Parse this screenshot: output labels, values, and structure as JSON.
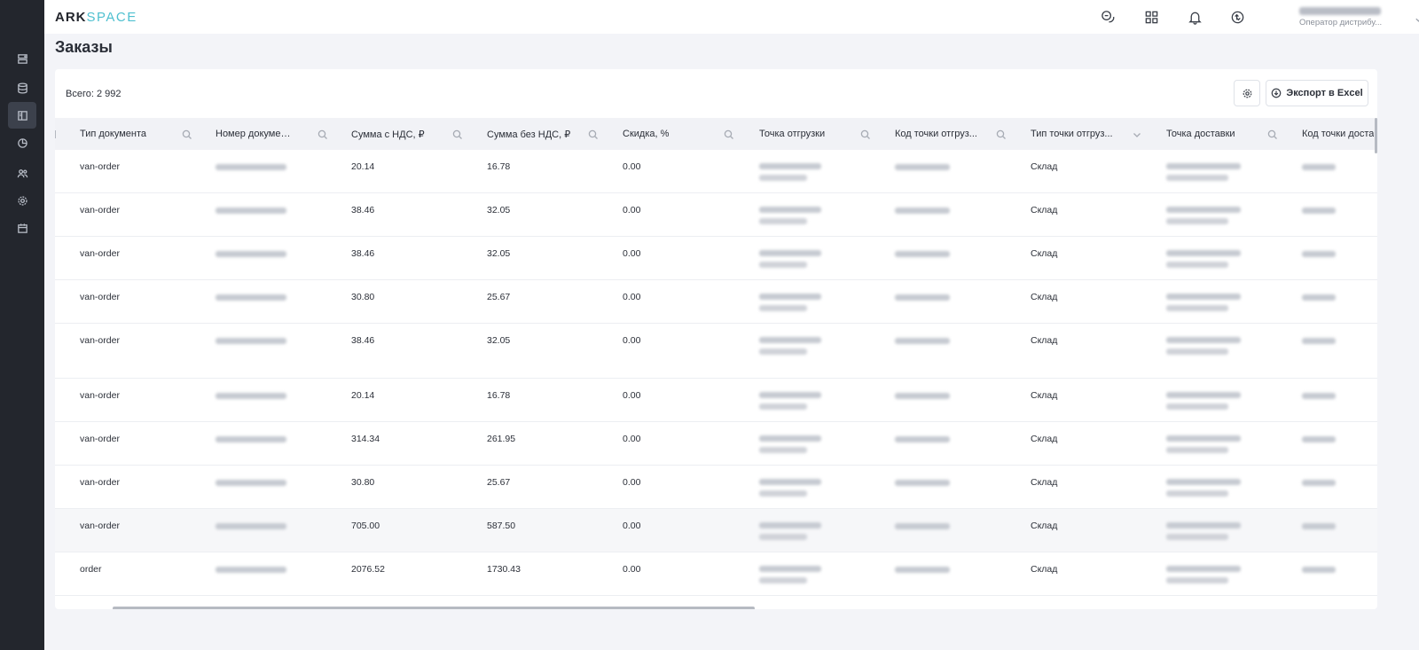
{
  "app": {
    "logo_part1": "ARK",
    "logo_part2": "SPACE",
    "user_role": "Оператор дистрибу...",
    "accent_color": "#4fc0d0"
  },
  "icons": {
    "sidebar": [
      "layers-icon",
      "database-icon",
      "orders-icon",
      "pie-chart-icon",
      "users-icon",
      "settings-icon",
      "calendar-icon"
    ],
    "header": [
      "chat-icon",
      "apps-grid-icon",
      "bell-icon",
      "sync-icon"
    ]
  },
  "page": {
    "title": "Заказы",
    "total_label": "Всего: 2 992",
    "export_label": "Экспорт в Excel"
  },
  "table": {
    "columns": [
      {
        "label": "Тип документа",
        "filter": "search"
      },
      {
        "label": "Номер докумен...",
        "filter": "search"
      },
      {
        "label": "Сумма с НДС, ₽",
        "filter": "search"
      },
      {
        "label": "Сумма без НДС, ₽",
        "filter": "search"
      },
      {
        "label": "Скидка, %",
        "filter": "search"
      },
      {
        "label": "Точка отгрузки",
        "filter": "search"
      },
      {
        "label": "Код точки отгруз...",
        "filter": "search"
      },
      {
        "label": "Тип точки отгруз...",
        "filter": "dropdown"
      },
      {
        "label": "Точка доставки",
        "filter": "search"
      },
      {
        "label": "Код точки доста",
        "filter": "none"
      }
    ],
    "rows": [
      {
        "doc_type": "van-order",
        "sum_vat": "20.14",
        "sum_novat": "16.78",
        "discount": "0.00",
        "ship_type": "Склад"
      },
      {
        "doc_type": "van-order",
        "sum_vat": "38.46",
        "sum_novat": "32.05",
        "discount": "0.00",
        "ship_type": "Склад"
      },
      {
        "doc_type": "van-order",
        "sum_vat": "38.46",
        "sum_novat": "32.05",
        "discount": "0.00",
        "ship_type": "Склад"
      },
      {
        "doc_type": "van-order",
        "sum_vat": "30.80",
        "sum_novat": "25.67",
        "discount": "0.00",
        "ship_type": "Склад"
      },
      {
        "doc_type": "van-order",
        "sum_vat": "38.46",
        "sum_novat": "32.05",
        "discount": "0.00",
        "ship_type": "Склад"
      },
      {
        "doc_type": "van-order",
        "sum_vat": "20.14",
        "sum_novat": "16.78",
        "discount": "0.00",
        "ship_type": "Склад"
      },
      {
        "doc_type": "van-order",
        "sum_vat": "314.34",
        "sum_novat": "261.95",
        "discount": "0.00",
        "ship_type": "Склад"
      },
      {
        "doc_type": "van-order",
        "sum_vat": "30.80",
        "sum_novat": "25.67",
        "discount": "0.00",
        "ship_type": "Склад"
      },
      {
        "doc_type": "van-order",
        "sum_vat": "705.00",
        "sum_novat": "587.50",
        "discount": "0.00",
        "ship_type": "Склад"
      },
      {
        "doc_type": "order",
        "sum_vat": "2076.52",
        "sum_novat": "1730.43",
        "discount": "0.00",
        "ship_type": "Склад"
      }
    ]
  }
}
